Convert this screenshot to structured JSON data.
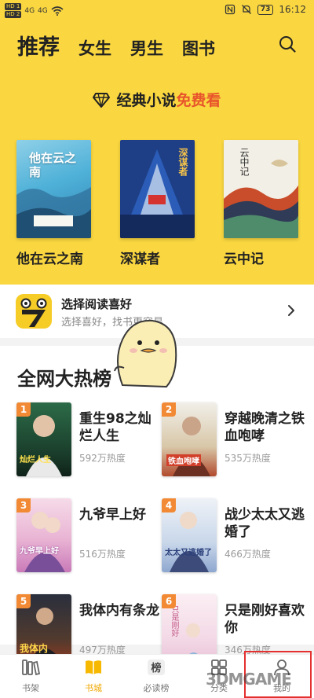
{
  "status_bar": {
    "sim1": "HD 1",
    "sim2": "HD 2",
    "net1": "4G",
    "net2": "4G",
    "battery": "73",
    "time": "16:12"
  },
  "header": {
    "tabs": [
      {
        "label": "推荐",
        "active": true
      },
      {
        "label": "女生",
        "active": false
      },
      {
        "label": "男生",
        "active": false
      },
      {
        "label": "图书",
        "active": false
      }
    ],
    "search_icon": "search-icon"
  },
  "promo": {
    "text_main": "经典小说",
    "text_free": "免费看",
    "icon": "diamond-icon"
  },
  "featured_books": [
    {
      "title": "他在云之南",
      "cover_text": "他在云之南"
    },
    {
      "title": "深谋者",
      "cover_text": "深谋者"
    },
    {
      "title": "云中记",
      "cover_text": "云中记"
    }
  ],
  "preferences": {
    "title": "选择阅读喜好",
    "subtitle": "选择喜好，找书更容易"
  },
  "hot_list": {
    "title": "全网大热榜",
    "items": [
      {
        "rank": "1",
        "title": "重生98之灿烂人生",
        "heat": "592万热度",
        "cover_text": "灿烂人生"
      },
      {
        "rank": "2",
        "title": "穿越晚清之铁血咆哮",
        "heat": "535万热度",
        "cover_text": "铁血咆哮"
      },
      {
        "rank": "3",
        "title": "九爷早上好",
        "heat": "516万热度",
        "cover_text": "九爷早上好"
      },
      {
        "rank": "4",
        "title": "战少太太又逃婚了",
        "heat": "466万热度",
        "cover_text": "太太又逃婚了"
      },
      {
        "rank": "5",
        "title": "我体内有条龙",
        "heat": "497万热度",
        "cover_text": "我体内"
      },
      {
        "rank": "6",
        "title": "只是刚好喜欢你",
        "heat": "346万热度",
        "cover_text": "只是刚好"
      }
    ]
  },
  "bottom_nav": [
    {
      "label": "书架",
      "icon": "bookshelf-icon",
      "active": false
    },
    {
      "label": "书城",
      "icon": "book-store-icon",
      "active": true
    },
    {
      "label": "必读榜",
      "icon": "ranking-icon",
      "active": false
    },
    {
      "label": "分类",
      "icon": "grid-icon",
      "active": false
    },
    {
      "label": "我的",
      "icon": "profile-icon",
      "active": false
    }
  ],
  "watermark": "3DMGAME",
  "colors": {
    "brand_yellow": "#fad740",
    "accent_orange": "#e8542b",
    "rank_badge": "#f28a35",
    "highlight_red": "#e53030"
  }
}
